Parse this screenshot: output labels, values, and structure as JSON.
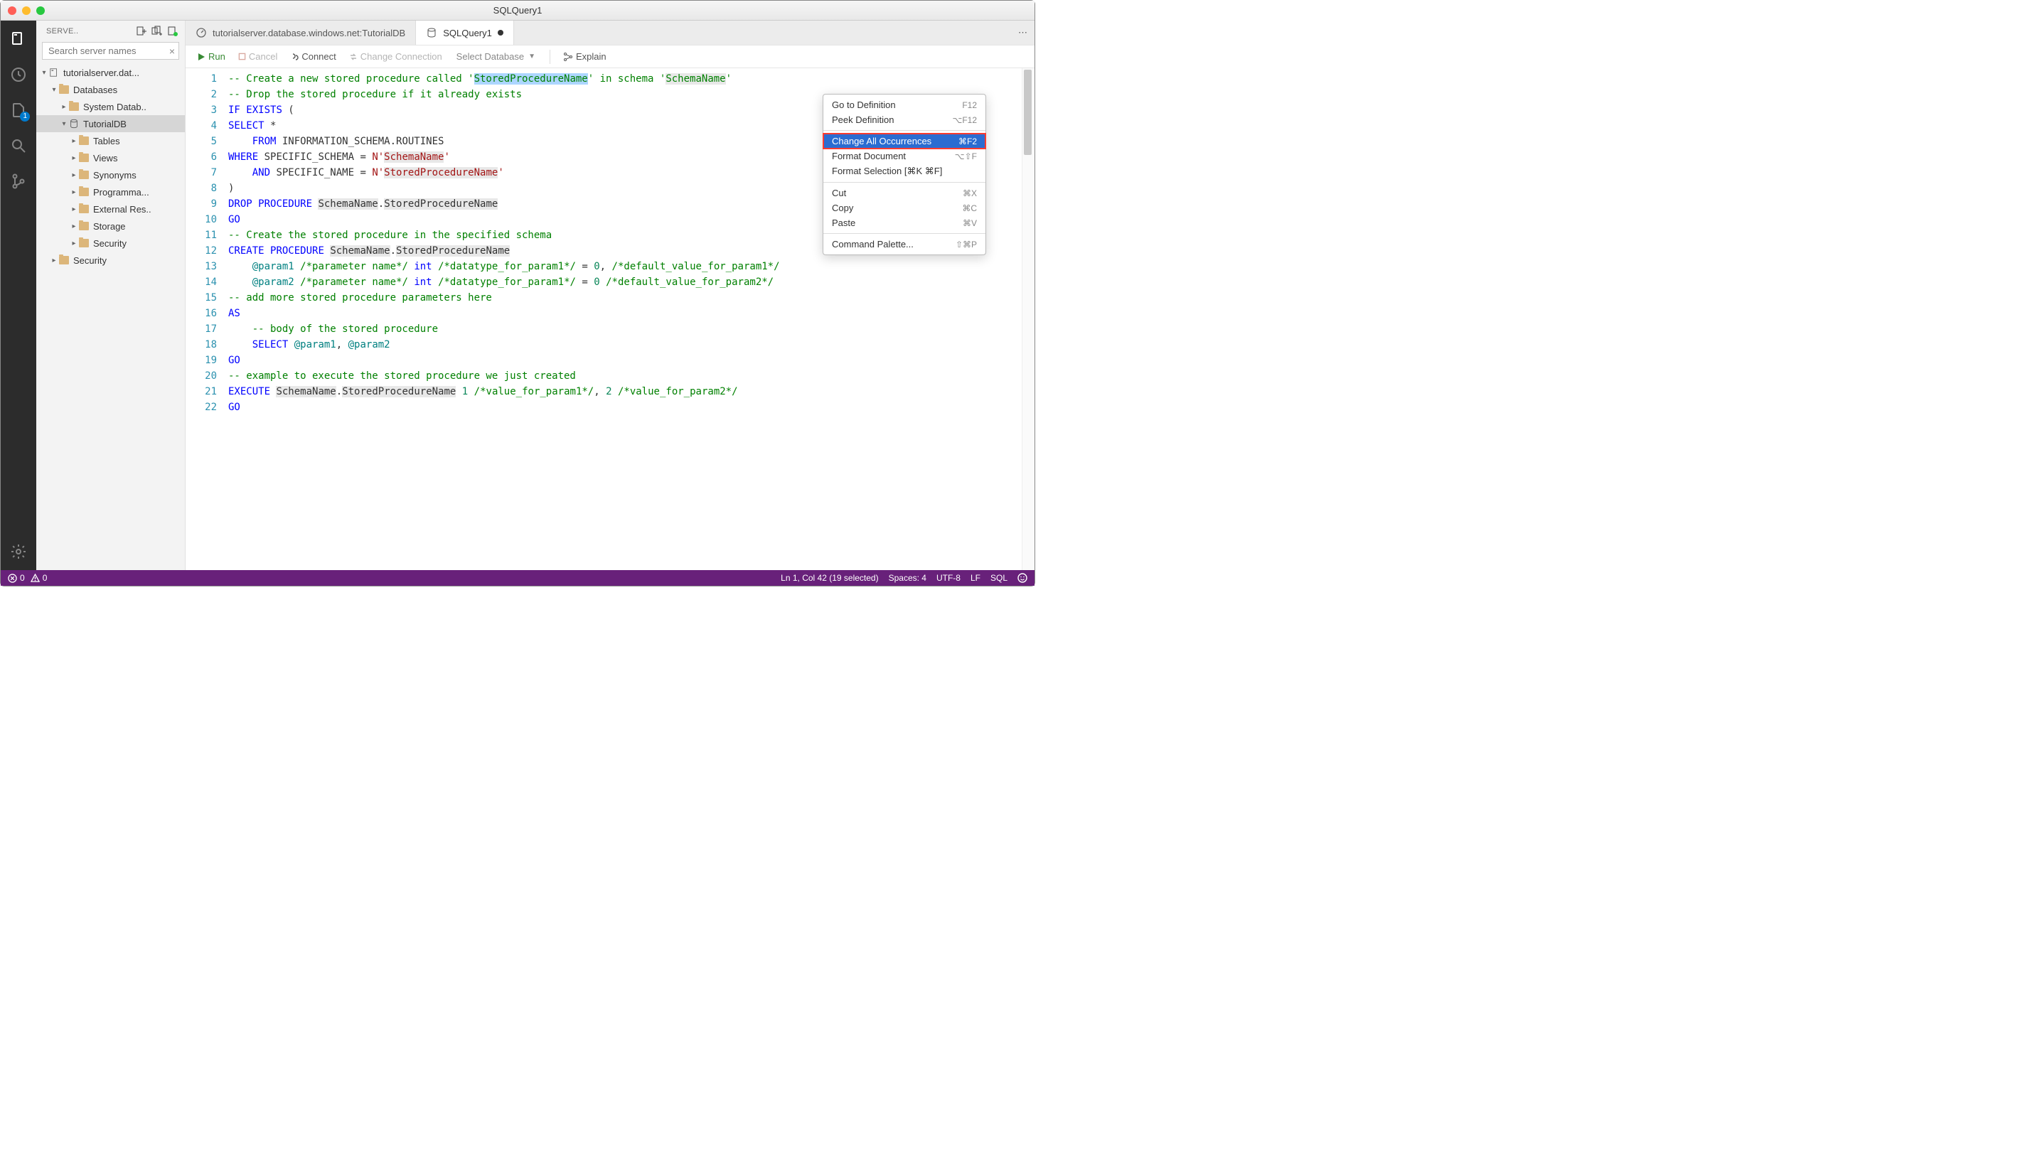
{
  "title": "SQLQuery1",
  "sidebar": {
    "heading": "SERVE..",
    "search_placeholder": "Search server names",
    "server_name": "tutorialserver.dat...",
    "databases": "Databases",
    "items": {
      "system_db": "System Datab..",
      "tutorialdb": "TutorialDB",
      "tables": "Tables",
      "views": "Views",
      "synonyms": "Synonyms",
      "programma": "Programma...",
      "external": "External Res..",
      "storage": "Storage",
      "security_inner": "Security",
      "security_outer": "Security"
    }
  },
  "tabs": {
    "t1": "tutorialserver.database.windows.net:TutorialDB",
    "t2": "SQLQuery1"
  },
  "toolbar": {
    "run": "Run",
    "cancel": "Cancel",
    "connect": "Connect",
    "change_conn": "Change Connection",
    "select_db": "Select Database",
    "explain": "Explain"
  },
  "code_lines": [
    "-- Create a new stored procedure called 'StoredProcedureName' in schema 'SchemaName'",
    "-- Drop the stored procedure if it already exists",
    "IF EXISTS (",
    "SELECT *",
    "    FROM INFORMATION_SCHEMA.ROUTINES",
    "WHERE SPECIFIC_SCHEMA = N'SchemaName'",
    "    AND SPECIFIC_NAME = N'StoredProcedureName'",
    ")",
    "DROP PROCEDURE SchemaName.StoredProcedureName",
    "GO",
    "-- Create the stored procedure in the specified schema",
    "CREATE PROCEDURE SchemaName.StoredProcedureName",
    "    @param1 /*parameter name*/ int /*datatype_for_param1*/ = 0, /*default_value_for_param1*/",
    "    @param2 /*parameter name*/ int /*datatype_for_param1*/ = 0 /*default_value_for_param2*/",
    "-- add more stored procedure parameters here",
    "AS",
    "    -- body of the stored procedure",
    "    SELECT @param1, @param2",
    "GO",
    "-- example to execute the stored procedure we just created",
    "EXECUTE SchemaName.StoredProcedureName 1 /*value_for_param1*/, 2 /*value_for_param2*/",
    "GO"
  ],
  "context_menu": {
    "goto_def": {
      "label": "Go to Definition",
      "shortcut": "F12"
    },
    "peek_def": {
      "label": "Peek Definition",
      "shortcut": "⌥F12"
    },
    "change_all": {
      "label": "Change All Occurrences",
      "shortcut": "⌘F2"
    },
    "format_doc": {
      "label": "Format Document",
      "shortcut": "⌥⇧F"
    },
    "format_sel": {
      "label": "Format Selection [⌘K ⌘F]",
      "shortcut": ""
    },
    "cut": {
      "label": "Cut",
      "shortcut": "⌘X"
    },
    "copy": {
      "label": "Copy",
      "shortcut": "⌘C"
    },
    "paste": {
      "label": "Paste",
      "shortcut": "⌘V"
    },
    "palette": {
      "label": "Command Palette...",
      "shortcut": "⇧⌘P"
    }
  },
  "status": {
    "errors": "0",
    "warnings": "0",
    "cursor": "Ln 1, Col 42 (19 selected)",
    "spaces": "Spaces: 4",
    "encoding": "UTF-8",
    "eol": "LF",
    "lang": "SQL"
  },
  "badge": "1"
}
